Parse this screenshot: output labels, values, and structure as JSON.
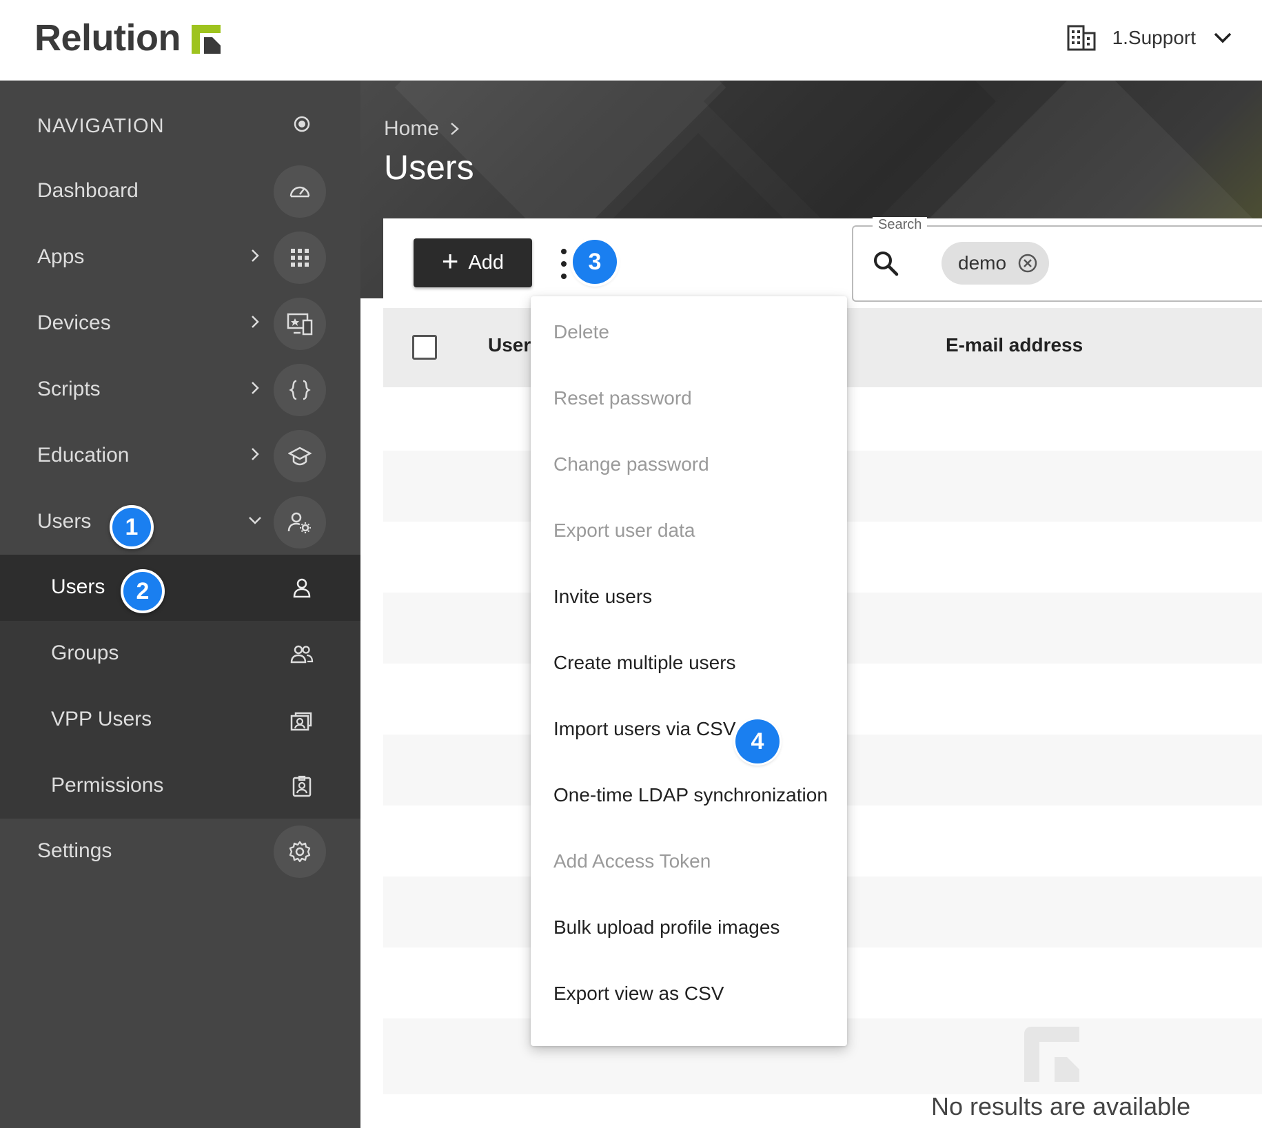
{
  "header": {
    "logo_text": "Relution",
    "org_name": "1.Support",
    "logo_colors": {
      "green": "#9ec31e",
      "dark": "#3a3a3a"
    }
  },
  "sidebar": {
    "section_title": "NAVIGATION",
    "items": [
      {
        "label": "Dashboard",
        "icon": "gauge-icon",
        "has_chevron": false
      },
      {
        "label": "Apps",
        "icon": "grid-icon",
        "has_chevron": true
      },
      {
        "label": "Devices",
        "icon": "devices-icon",
        "has_chevron": true
      },
      {
        "label": "Scripts",
        "icon": "braces-icon",
        "has_chevron": true
      },
      {
        "label": "Education",
        "icon": "graduation-cap-icon",
        "has_chevron": true
      },
      {
        "label": "Users",
        "icon": "users-gear-icon",
        "has_chevron": true,
        "expanded": true
      }
    ],
    "sub_items": [
      {
        "label": "Users",
        "icon": "user-icon",
        "active": true
      },
      {
        "label": "Groups",
        "icon": "group-icon",
        "active": false
      },
      {
        "label": "VPP Users",
        "icon": "vpp-icon",
        "active": false
      },
      {
        "label": "Permissions",
        "icon": "id-badge-icon",
        "active": false
      }
    ],
    "settings": {
      "label": "Settings",
      "icon": "gear-icon"
    }
  },
  "page": {
    "breadcrumb": "Home",
    "title": "Users"
  },
  "toolbar": {
    "add_label": "Add",
    "search_legend": "Search",
    "search_chip": "demo"
  },
  "table": {
    "columns": [
      "User",
      "E-mail address"
    ],
    "empty_text": "No results are available"
  },
  "menu": {
    "items": [
      {
        "label": "Delete",
        "disabled": true
      },
      {
        "label": "Reset password",
        "disabled": true
      },
      {
        "label": "Change password",
        "disabled": true
      },
      {
        "label": "Export user data",
        "disabled": true
      },
      {
        "label": "Invite users",
        "disabled": false
      },
      {
        "label": "Create multiple users",
        "disabled": false
      },
      {
        "label": "Import users via CSV",
        "disabled": false
      },
      {
        "label": "One-time LDAP synchronization",
        "disabled": false
      },
      {
        "label": "Add Access Token",
        "disabled": true
      },
      {
        "label": "Bulk upload profile images",
        "disabled": false
      },
      {
        "label": "Export view as CSV",
        "disabled": false
      }
    ]
  },
  "annotations": {
    "step1": "1",
    "step2": "2",
    "step3": "3",
    "step4": "4",
    "badge_color": "#1a7ff0"
  }
}
